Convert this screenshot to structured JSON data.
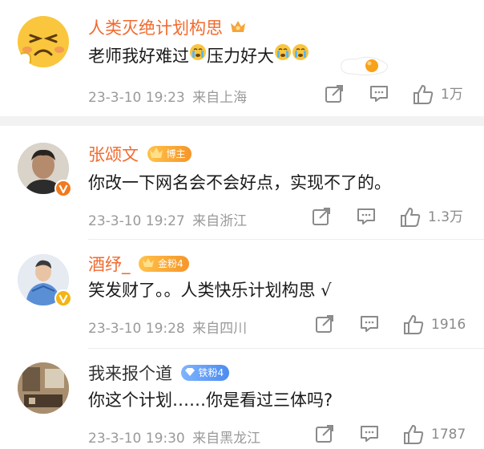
{
  "comments": [
    {
      "username": "人类灭绝计划构思",
      "content_parts": [
        "老师我好难过",
        "压力好大"
      ],
      "emoji": "crying-emoji",
      "time": "23-3-10 19:23",
      "location": "来自上海",
      "likes": "1万"
    },
    {
      "username": "张颂文",
      "badge": "博主",
      "content": "你改一下网名会不会好点，实现不了的。",
      "time": "23-3-10 19:27",
      "location": "来自浙江",
      "likes": "1.3万"
    },
    {
      "username": "酒纾_",
      "badge": "金粉4",
      "content": "笑发财了。。人类快乐计划构思 √",
      "time": "23-3-10 19:28",
      "location": "来自四川",
      "likes": "1916"
    },
    {
      "username": "我来报个道",
      "badge": "铁粉4",
      "content": "你这个计划……你是看过三体吗?",
      "time": "23-3-10 19:30",
      "location": "来自黑龙江",
      "likes": "1787"
    }
  ],
  "colors": {
    "username_highlight": "#f26a2e",
    "meta_text": "#9a9a9a",
    "divider": "#f2f2f2",
    "gold_badge": "#f5962a",
    "fan_badge": "#4d8bf0",
    "verified_orange": "#f07a1e",
    "verified_gold": "#f3b514"
  },
  "icons": {
    "share": "share-icon",
    "comment": "comment-icon",
    "like": "thumbs-up-icon",
    "member": "crown-icon",
    "verified": "verified-v-icon"
  }
}
